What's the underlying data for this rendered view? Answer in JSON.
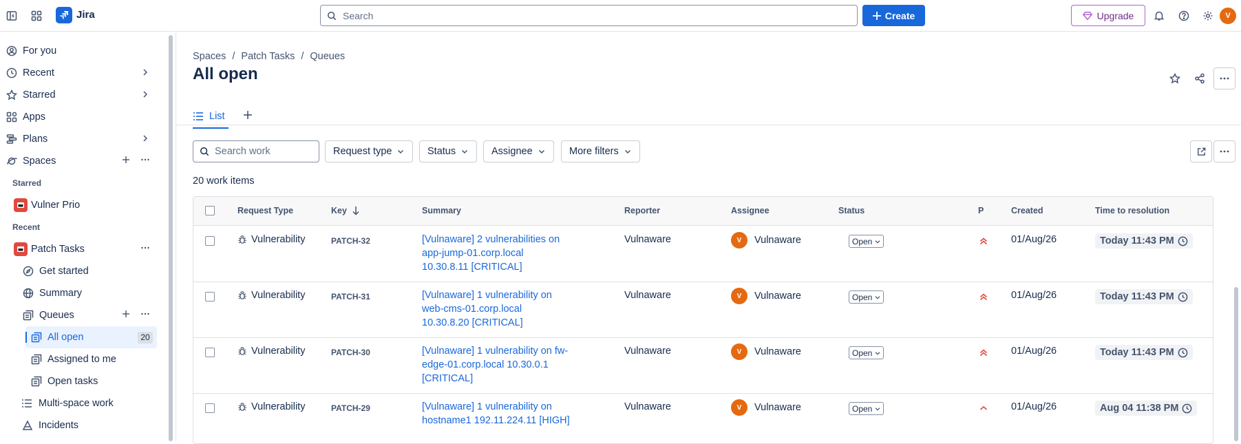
{
  "topbar": {
    "app_name": "Jira",
    "search_placeholder": "Search",
    "create_label": "Create",
    "upgrade_label": "Upgrade",
    "user_initial": "V"
  },
  "sidebar": {
    "items": [
      {
        "label": "For you",
        "icon": "person-circle-icon"
      },
      {
        "label": "Recent",
        "icon": "clock-icon"
      },
      {
        "label": "Starred",
        "icon": "star-icon"
      },
      {
        "label": "Apps",
        "icon": "apps-icon"
      },
      {
        "label": "Plans",
        "icon": "plans-icon"
      },
      {
        "label": "Spaces",
        "icon": "planet-icon"
      }
    ],
    "starred_heading": "Starred",
    "starred_space": "Vulner Prio",
    "recent_heading": "Recent",
    "recent_space": "Patch Tasks",
    "space_children": [
      {
        "label": "Get started",
        "icon": "compass-icon"
      },
      {
        "label": "Summary",
        "icon": "globe-icon"
      },
      {
        "label": "Queues",
        "icon": "queue-icon"
      }
    ],
    "queues": [
      {
        "label": "All open",
        "count": "20",
        "selected": true
      },
      {
        "label": "Assigned to me"
      },
      {
        "label": "Open tasks"
      }
    ],
    "bottom_items": [
      {
        "label": "Multi-space work",
        "icon": "list-icon"
      },
      {
        "label": "Incidents",
        "icon": "incident-icon"
      }
    ]
  },
  "main": {
    "breadcrumbs": [
      "Spaces",
      "Patch Tasks",
      "Queues"
    ],
    "title": "All open",
    "tab_label": "List",
    "search_placeholder": "Search work",
    "filters": [
      "Request type",
      "Status",
      "Assignee",
      "More filters"
    ],
    "work_count": "20 work items",
    "columns": [
      "Request Type",
      "Key",
      "Summary",
      "Reporter",
      "Assignee",
      "Status",
      "P",
      "Created",
      "Time to resolution"
    ],
    "rows": [
      {
        "type": "Vulnerability",
        "key": "PATCH-32",
        "summary": "[Vulnaware] 2 vulnerabilities on app-jump-01.corp.local 10.30.8.11 [CRITICAL]",
        "reporter": "Vulnaware",
        "assignee": "Vulnaware",
        "assignee_initial": "V",
        "status": "Open",
        "priority": "highest",
        "created": "01/Aug/26",
        "ttr": "Today 11:43 PM"
      },
      {
        "type": "Vulnerability",
        "key": "PATCH-31",
        "summary": "[Vulnaware] 1 vulnerability on web-cms-01.corp.local 10.30.8.20 [CRITICAL]",
        "reporter": "Vulnaware",
        "assignee": "Vulnaware",
        "assignee_initial": "V",
        "status": "Open",
        "priority": "highest",
        "created": "01/Aug/26",
        "ttr": "Today 11:43 PM"
      },
      {
        "type": "Vulnerability",
        "key": "PATCH-30",
        "summary": "[Vulnaware] 1 vulnerability on fw-edge-01.corp.local 10.30.0.1 [CRITICAL]",
        "reporter": "Vulnaware",
        "assignee": "Vulnaware",
        "assignee_initial": "V",
        "status": "Open",
        "priority": "highest",
        "created": "01/Aug/26",
        "ttr": "Today 11:43 PM"
      },
      {
        "type": "Vulnerability",
        "key": "PATCH-29",
        "summary": "[Vulnaware] 1 vulnerability on hostname1 192.11.224.11 [HIGH]",
        "reporter": "Vulnaware",
        "assignee": "Vulnaware",
        "assignee_initial": "V",
        "status": "Open",
        "priority": "high",
        "created": "01/Aug/26",
        "ttr": "Aug 04 11:38 PM"
      }
    ]
  },
  "colors": {
    "brand": "#1868db",
    "priority": "#e2483d",
    "avatar": "#e56910",
    "upgrade": "#b063d1"
  }
}
